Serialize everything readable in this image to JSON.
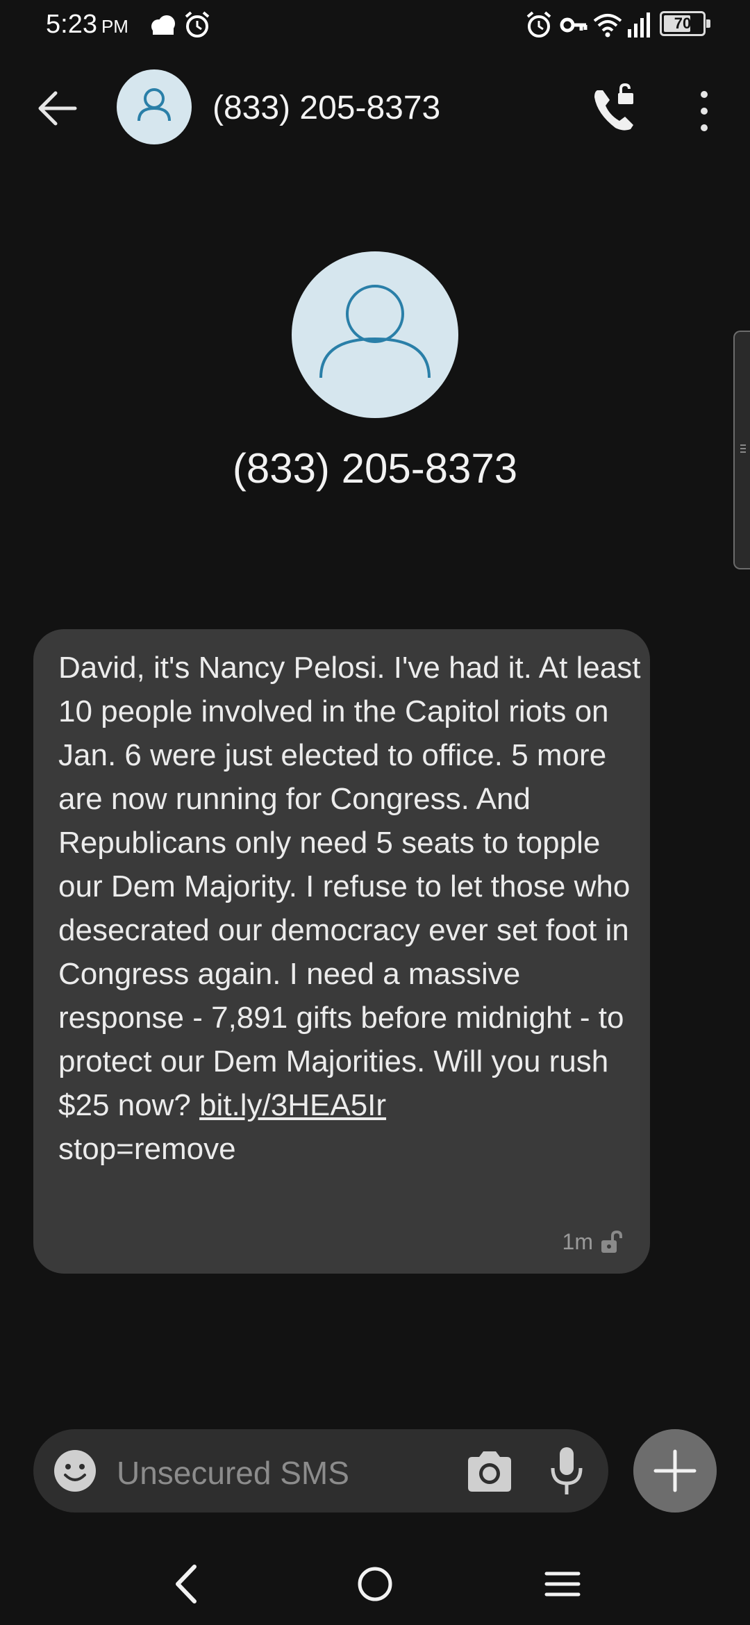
{
  "status_bar": {
    "time": "5:23",
    "ampm": "PM",
    "battery": "70",
    "battery_level": 0.7,
    "icons": [
      "weather-icon",
      "alarm-icon",
      "alarm-icon",
      "vpn-key-icon",
      "wifi-icon",
      "signal-icon",
      "battery-icon"
    ]
  },
  "header": {
    "title": "(833) 205-8373"
  },
  "contact": {
    "number": "(833) 205-8373"
  },
  "message": {
    "text": "David, it's Nancy Pelosi. I've had it. At least 10 people involved in the Capitol riots on Jan. 6 were just elected to office. 5 more are now running for Congress. And Republicans only need 5 seats to topple our Dem Majority. I refuse to let those who desecrated our democracy ever set foot in Congress again. I need a massive response - 7,891 gifts before midnight - to protect our Dem Majorities. Will you rush $25 now? ",
    "link": "bit.ly/3HEA5Ir",
    "text_after": "stop=remove",
    "time": "1m"
  },
  "compose": {
    "placeholder": "Unsecured SMS"
  },
  "colors": {
    "background": "#121212",
    "bubble": "#3a3a3a",
    "avatar_bg": "#d6e6ee",
    "avatar_fg": "#2a7fa8"
  }
}
